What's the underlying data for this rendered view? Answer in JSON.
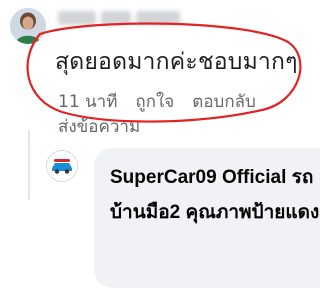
{
  "comment": {
    "author_avatar": "user-avatar",
    "text": "สุดยอดมากค่ะชอบมากๆ",
    "time": "11 นาที",
    "like_label": "ถูกใจ",
    "reply_label": "ตอบกลับ",
    "send_message_label": "ส่งข้อความ",
    "highlight_color": "#e02424"
  },
  "reply": {
    "author_avatar": "page-logo",
    "author": "SuperCar09 Official",
    "text": "SuperCar09 Official รถบ้านมือ2 คุณภาพป้ายแดง"
  },
  "colors": {
    "bubble": "#f0f2f5",
    "meta_text": "#65676b",
    "text": "#1c1e21"
  }
}
